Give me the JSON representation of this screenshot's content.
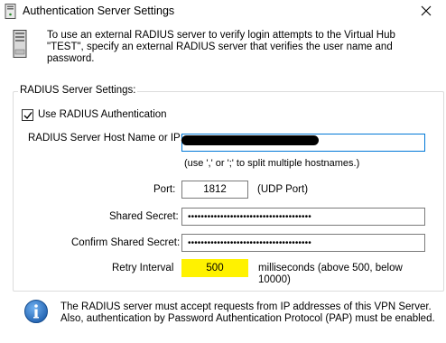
{
  "window": {
    "title": "Authentication Server Settings",
    "close_icon": "close-icon"
  },
  "intro": {
    "icon": "server-tower-icon",
    "text": "To use an external RADIUS server to verify login attempts to the Virtual Hub \"TEST\", specify an external RADIUS server that verifies the user name and password."
  },
  "group": {
    "legend": "RADIUS Server Settings:",
    "use_radius": {
      "label": "Use RADIUS Authentication",
      "checked": true
    },
    "hostname": {
      "label": "RADIUS Server Host Name or IP:",
      "value_redacted": true,
      "hint": "(use ',' or ';' to split multiple hostnames.)"
    },
    "port": {
      "label": "Port:",
      "value": "1812",
      "note": "(UDP Port)"
    },
    "shared_secret": {
      "label": "Shared Secret:",
      "masked_value": "••••••••••••••••••••••••••••••••••••••"
    },
    "confirm_secret": {
      "label": "Confirm Shared Secret:",
      "masked_value": "••••••••••••••••••••••••••••••••••••••"
    },
    "retry": {
      "label": "Retry Interval",
      "value": "500",
      "note": "milliseconds (above 500, below 10000)",
      "highlight_color": "#fff200"
    }
  },
  "footer": {
    "icon": "info-icon",
    "text": "The RADIUS server must accept requests from IP addresses of this VPN Server. Also, authentication by Password Authentication Protocol (PAP) must be enabled."
  },
  "colors": {
    "focus_border": "#0078d7",
    "info_blue": "#1f6fc4"
  }
}
